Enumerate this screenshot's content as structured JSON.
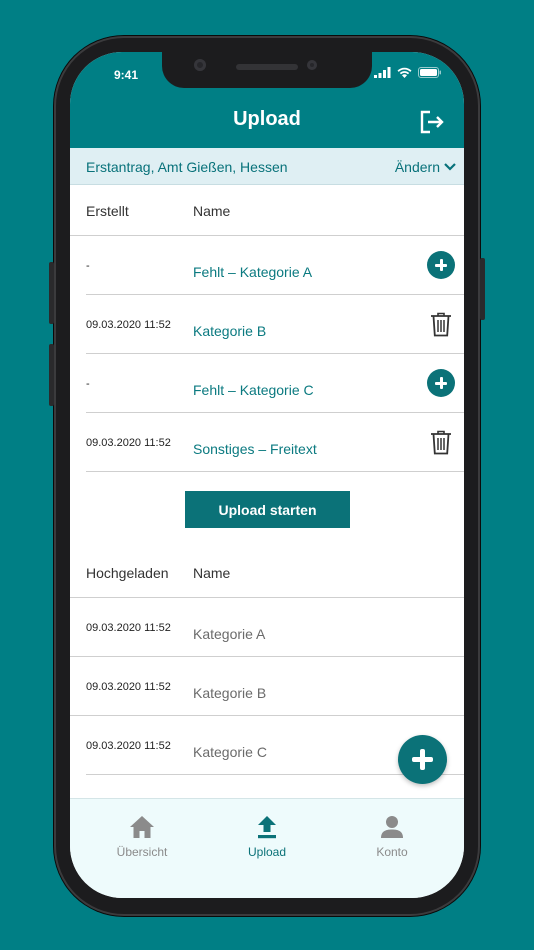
{
  "status_bar": {
    "time": "9:41"
  },
  "header": {
    "title": "Upload",
    "logout_icon": "logout-icon"
  },
  "context": {
    "label": "Erstantrag, Amt Gießen, Hessen",
    "change_label": "Ändern"
  },
  "pending": {
    "col_created": "Erstellt",
    "col_name": "Name",
    "rows": [
      {
        "date": "-",
        "name": "Fehlt – Kategorie A",
        "action": "add"
      },
      {
        "date": "09.03.2020 11:52",
        "name": "Kategorie B",
        "action": "delete"
      },
      {
        "date": "-",
        "name": "Fehlt – Kategorie C",
        "action": "add"
      },
      {
        "date": "09.03.2020 11:52",
        "name": "Sonstiges – Freitext",
        "action": "delete"
      }
    ]
  },
  "upload_button": {
    "label": "Upload starten"
  },
  "uploaded": {
    "col_uploaded": "Hochgeladen",
    "col_name": "Name",
    "rows": [
      {
        "date": "09.03.2020 11:52",
        "name": "Kategorie A"
      },
      {
        "date": "09.03.2020 11:52",
        "name": "Kategorie B"
      },
      {
        "date": "09.03.2020 11:52",
        "name": "Kategorie C"
      }
    ]
  },
  "fab": {
    "icon": "plus-icon"
  },
  "nav": {
    "items": [
      {
        "label": "Übersicht",
        "icon": "home-icon"
      },
      {
        "label": "Upload",
        "icon": "upload-icon"
      },
      {
        "label": "Konto",
        "icon": "person-icon"
      }
    ],
    "active": "Upload"
  },
  "colors": {
    "brand": "#007f85",
    "accent": "#0b7278",
    "context_bg": "#dfeff3",
    "nav_bg": "#eefbfc"
  }
}
